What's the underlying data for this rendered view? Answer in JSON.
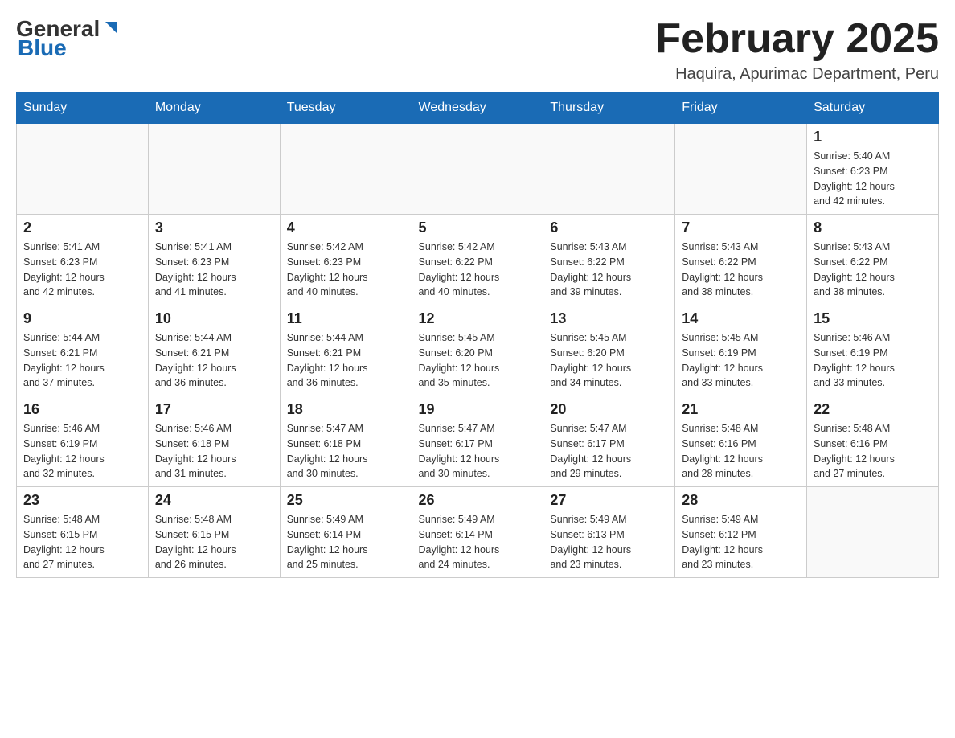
{
  "header": {
    "logo": {
      "text_general": "General",
      "text_blue": "Blue"
    },
    "title": "February 2025",
    "subtitle": "Haquira, Apurimac Department, Peru"
  },
  "days_of_week": [
    "Sunday",
    "Monday",
    "Tuesday",
    "Wednesday",
    "Thursday",
    "Friday",
    "Saturday"
  ],
  "weeks": [
    {
      "days": [
        {
          "number": "",
          "info": ""
        },
        {
          "number": "",
          "info": ""
        },
        {
          "number": "",
          "info": ""
        },
        {
          "number": "",
          "info": ""
        },
        {
          "number": "",
          "info": ""
        },
        {
          "number": "",
          "info": ""
        },
        {
          "number": "1",
          "info": "Sunrise: 5:40 AM\nSunset: 6:23 PM\nDaylight: 12 hours\nand 42 minutes."
        }
      ]
    },
    {
      "days": [
        {
          "number": "2",
          "info": "Sunrise: 5:41 AM\nSunset: 6:23 PM\nDaylight: 12 hours\nand 42 minutes."
        },
        {
          "number": "3",
          "info": "Sunrise: 5:41 AM\nSunset: 6:23 PM\nDaylight: 12 hours\nand 41 minutes."
        },
        {
          "number": "4",
          "info": "Sunrise: 5:42 AM\nSunset: 6:23 PM\nDaylight: 12 hours\nand 40 minutes."
        },
        {
          "number": "5",
          "info": "Sunrise: 5:42 AM\nSunset: 6:22 PM\nDaylight: 12 hours\nand 40 minutes."
        },
        {
          "number": "6",
          "info": "Sunrise: 5:43 AM\nSunset: 6:22 PM\nDaylight: 12 hours\nand 39 minutes."
        },
        {
          "number": "7",
          "info": "Sunrise: 5:43 AM\nSunset: 6:22 PM\nDaylight: 12 hours\nand 38 minutes."
        },
        {
          "number": "8",
          "info": "Sunrise: 5:43 AM\nSunset: 6:22 PM\nDaylight: 12 hours\nand 38 minutes."
        }
      ]
    },
    {
      "days": [
        {
          "number": "9",
          "info": "Sunrise: 5:44 AM\nSunset: 6:21 PM\nDaylight: 12 hours\nand 37 minutes."
        },
        {
          "number": "10",
          "info": "Sunrise: 5:44 AM\nSunset: 6:21 PM\nDaylight: 12 hours\nand 36 minutes."
        },
        {
          "number": "11",
          "info": "Sunrise: 5:44 AM\nSunset: 6:21 PM\nDaylight: 12 hours\nand 36 minutes."
        },
        {
          "number": "12",
          "info": "Sunrise: 5:45 AM\nSunset: 6:20 PM\nDaylight: 12 hours\nand 35 minutes."
        },
        {
          "number": "13",
          "info": "Sunrise: 5:45 AM\nSunset: 6:20 PM\nDaylight: 12 hours\nand 34 minutes."
        },
        {
          "number": "14",
          "info": "Sunrise: 5:45 AM\nSunset: 6:19 PM\nDaylight: 12 hours\nand 33 minutes."
        },
        {
          "number": "15",
          "info": "Sunrise: 5:46 AM\nSunset: 6:19 PM\nDaylight: 12 hours\nand 33 minutes."
        }
      ]
    },
    {
      "days": [
        {
          "number": "16",
          "info": "Sunrise: 5:46 AM\nSunset: 6:19 PM\nDaylight: 12 hours\nand 32 minutes."
        },
        {
          "number": "17",
          "info": "Sunrise: 5:46 AM\nSunset: 6:18 PM\nDaylight: 12 hours\nand 31 minutes."
        },
        {
          "number": "18",
          "info": "Sunrise: 5:47 AM\nSunset: 6:18 PM\nDaylight: 12 hours\nand 30 minutes."
        },
        {
          "number": "19",
          "info": "Sunrise: 5:47 AM\nSunset: 6:17 PM\nDaylight: 12 hours\nand 30 minutes."
        },
        {
          "number": "20",
          "info": "Sunrise: 5:47 AM\nSunset: 6:17 PM\nDaylight: 12 hours\nand 29 minutes."
        },
        {
          "number": "21",
          "info": "Sunrise: 5:48 AM\nSunset: 6:16 PM\nDaylight: 12 hours\nand 28 minutes."
        },
        {
          "number": "22",
          "info": "Sunrise: 5:48 AM\nSunset: 6:16 PM\nDaylight: 12 hours\nand 27 minutes."
        }
      ]
    },
    {
      "days": [
        {
          "number": "23",
          "info": "Sunrise: 5:48 AM\nSunset: 6:15 PM\nDaylight: 12 hours\nand 27 minutes."
        },
        {
          "number": "24",
          "info": "Sunrise: 5:48 AM\nSunset: 6:15 PM\nDaylight: 12 hours\nand 26 minutes."
        },
        {
          "number": "25",
          "info": "Sunrise: 5:49 AM\nSunset: 6:14 PM\nDaylight: 12 hours\nand 25 minutes."
        },
        {
          "number": "26",
          "info": "Sunrise: 5:49 AM\nSunset: 6:14 PM\nDaylight: 12 hours\nand 24 minutes."
        },
        {
          "number": "27",
          "info": "Sunrise: 5:49 AM\nSunset: 6:13 PM\nDaylight: 12 hours\nand 23 minutes."
        },
        {
          "number": "28",
          "info": "Sunrise: 5:49 AM\nSunset: 6:12 PM\nDaylight: 12 hours\nand 23 minutes."
        },
        {
          "number": "",
          "info": ""
        }
      ]
    }
  ]
}
